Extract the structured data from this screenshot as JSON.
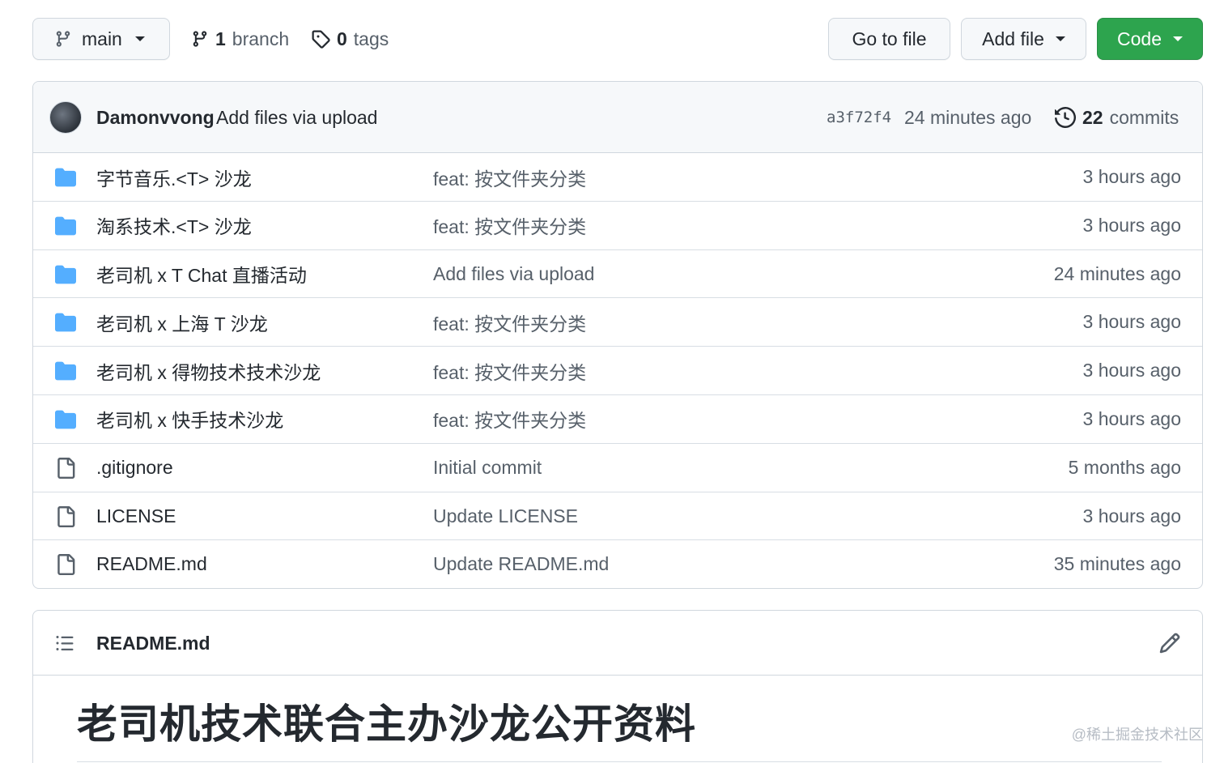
{
  "toolbar": {
    "branch_name": "main",
    "branch_count": "1",
    "branch_label": "branch",
    "tag_count": "0",
    "tag_label": "tags",
    "goto_file_label": "Go to file",
    "add_file_label": "Add file",
    "code_label": "Code",
    "code_color": "#2da44e"
  },
  "latest_commit": {
    "author": "Damonvvong",
    "message": "Add files via upload",
    "sha": "a3f72f4",
    "age": "24 minutes ago",
    "commit_count": "22",
    "commit_label": "commits"
  },
  "files": [
    {
      "type": "folder",
      "name": "字节音乐.<T> 沙龙",
      "message": "feat: 按文件夹分类",
      "age": "3 hours ago"
    },
    {
      "type": "folder",
      "name": "淘系技术.<T> 沙龙",
      "message": "feat: 按文件夹分类",
      "age": "3 hours ago"
    },
    {
      "type": "folder",
      "name": "老司机 x T Chat 直播活动",
      "message": "Add files via upload",
      "age": "24 minutes ago"
    },
    {
      "type": "folder",
      "name": "老司机 x 上海 T 沙龙",
      "message": "feat: 按文件夹分类",
      "age": "3 hours ago"
    },
    {
      "type": "folder",
      "name": "老司机 x 得物技术技术沙龙",
      "message": "feat: 按文件夹分类",
      "age": "3 hours ago"
    },
    {
      "type": "folder",
      "name": "老司机 x 快手技术沙龙",
      "message": "feat: 按文件夹分类",
      "age": "3 hours ago"
    },
    {
      "type": "file",
      "name": ".gitignore",
      "message": "Initial commit",
      "age": "5 months ago"
    },
    {
      "type": "file",
      "name": "LICENSE",
      "message": "Update LICENSE",
      "age": "3 hours ago"
    },
    {
      "type": "file",
      "name": "README.md",
      "message": "Update README.md",
      "age": "35 minutes ago"
    }
  ],
  "readme": {
    "filename": "README.md",
    "heading": "老司机技术联合主办沙龙公开资料"
  },
  "watermark": "@稀土掘金技术社区",
  "colors": {
    "folder": "#54aeff",
    "file_icon": "#57606a"
  }
}
